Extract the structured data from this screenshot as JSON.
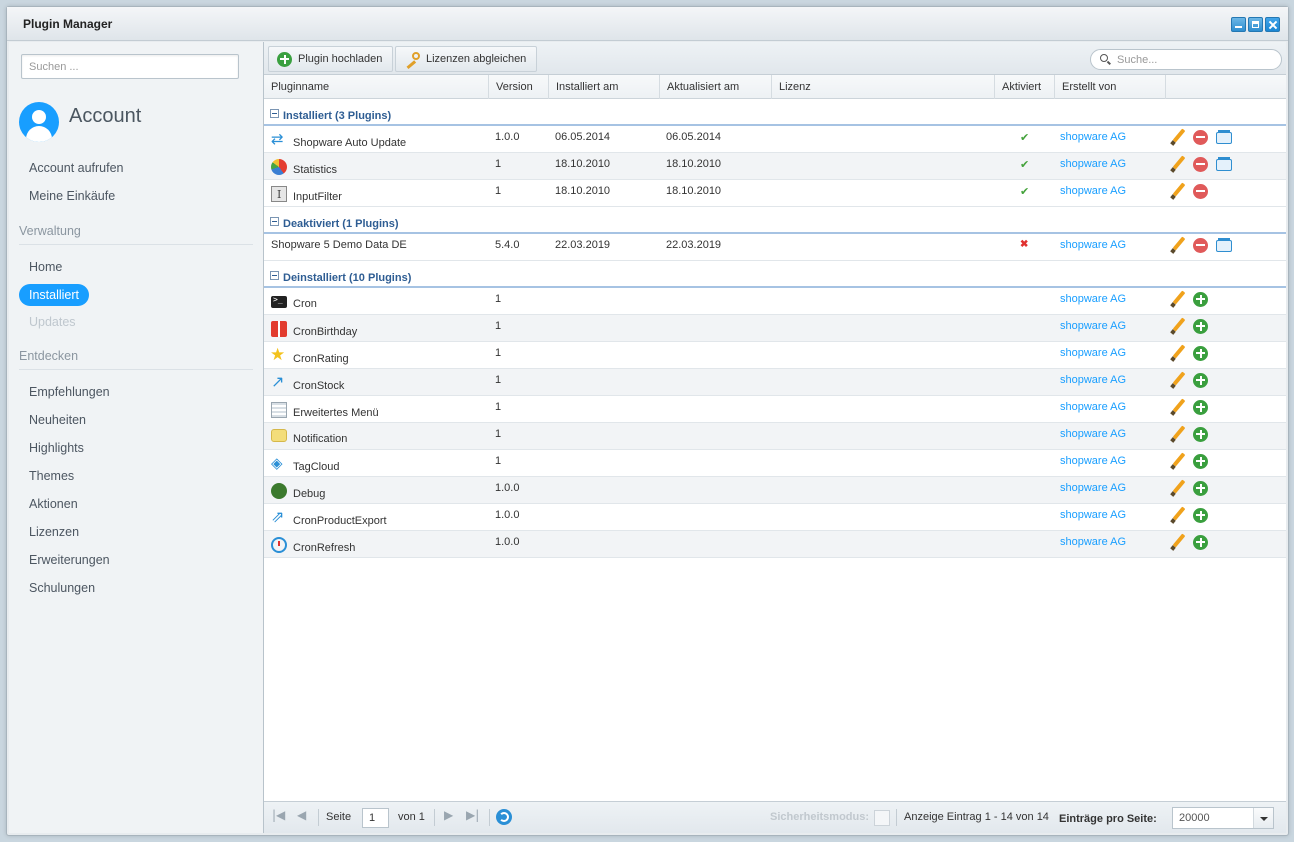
{
  "window": {
    "title": "Plugin Manager"
  },
  "sidebar": {
    "search_placeholder": "Suchen ...",
    "account_title": "Account",
    "account_links": [
      "Account aufrufen",
      "Meine Einkäufe"
    ],
    "section_verwaltung": "Verwaltung",
    "verwaltung_items": [
      {
        "label": "Home",
        "state": "normal"
      },
      {
        "label": "Installiert",
        "state": "active"
      },
      {
        "label": "Updates",
        "state": "disabled"
      }
    ],
    "section_entdecken": "Entdecken",
    "entdecken_items": [
      "Empfehlungen",
      "Neuheiten",
      "Highlights",
      "Themes",
      "Aktionen",
      "Lizenzen",
      "Erweiterungen",
      "Schulungen"
    ]
  },
  "toolbar": {
    "upload_label": "Plugin hochladen",
    "licenses_label": "Lizenzen abgleichen",
    "search_placeholder": "Suche..."
  },
  "columns": [
    "Pluginname",
    "Version",
    "Installiert am",
    "Aktualisiert am",
    "Lizenz",
    "Aktiviert",
    "Erstellt von"
  ],
  "groups": [
    {
      "title": "Installiert (3 Plugins)",
      "rows": [
        {
          "name": "Shopware Auto Update",
          "icon": "pi-update",
          "version": "1.0.0",
          "installed": "06.05.2014",
          "updated": "06.05.2014",
          "active": "check",
          "author": "shopware AG",
          "actions": [
            "edit",
            "uninstall",
            "update"
          ]
        },
        {
          "name": "Statistics",
          "icon": "pi-stats",
          "version": "1",
          "installed": "18.10.2010",
          "updated": "18.10.2010",
          "active": "check",
          "author": "shopware AG",
          "actions": [
            "edit",
            "uninstall",
            "update"
          ]
        },
        {
          "name": "InputFilter",
          "icon": "pi-input",
          "version": "1",
          "installed": "18.10.2010",
          "updated": "18.10.2010",
          "active": "check",
          "author": "shopware AG",
          "actions": [
            "edit",
            "uninstall"
          ]
        }
      ]
    },
    {
      "title": "Deaktiviert (1 Plugins)",
      "rows": [
        {
          "name": "Shopware 5 Demo Data DE",
          "icon": "",
          "version": "5.4.0",
          "installed": "22.03.2019",
          "updated": "22.03.2019",
          "active": "cross",
          "author": "shopware AG",
          "actions": [
            "edit",
            "uninstall",
            "update"
          ]
        }
      ]
    },
    {
      "title": "Deinstalliert (10 Plugins)",
      "rows": [
        {
          "name": "Cron",
          "icon": "pi-cron",
          "version": "1",
          "installed": "",
          "updated": "",
          "active": "",
          "author": "shopware AG",
          "actions": [
            "edit",
            "install"
          ]
        },
        {
          "name": "CronBirthday",
          "icon": "pi-gift",
          "version": "1",
          "installed": "",
          "updated": "",
          "active": "",
          "author": "shopware AG",
          "actions": [
            "edit",
            "install"
          ]
        },
        {
          "name": "CronRating",
          "icon": "pi-star",
          "version": "1",
          "installed": "",
          "updated": "",
          "active": "",
          "author": "shopware AG",
          "actions": [
            "edit",
            "install"
          ]
        },
        {
          "name": "CronStock",
          "icon": "pi-stock",
          "version": "1",
          "installed": "",
          "updated": "",
          "active": "",
          "author": "shopware AG",
          "actions": [
            "edit",
            "install"
          ]
        },
        {
          "name": "Erweitertes Menü",
          "icon": "pi-menu",
          "version": "1",
          "installed": "",
          "updated": "",
          "active": "",
          "author": "shopware AG",
          "actions": [
            "edit",
            "install"
          ]
        },
        {
          "name": "Notification",
          "icon": "pi-note",
          "version": "1",
          "installed": "",
          "updated": "",
          "active": "",
          "author": "shopware AG",
          "actions": [
            "edit",
            "install"
          ]
        },
        {
          "name": "TagCloud",
          "icon": "pi-tag",
          "version": "1",
          "installed": "",
          "updated": "",
          "active": "",
          "author": "shopware AG",
          "actions": [
            "edit",
            "install"
          ]
        },
        {
          "name": "Debug",
          "icon": "pi-bug",
          "version": "1.0.0",
          "installed": "",
          "updated": "",
          "active": "",
          "author": "shopware AG",
          "actions": [
            "edit",
            "install"
          ]
        },
        {
          "name": "CronProductExport",
          "icon": "pi-export",
          "version": "1.0.0",
          "installed": "",
          "updated": "",
          "active": "",
          "author": "shopware AG",
          "actions": [
            "edit",
            "install"
          ]
        },
        {
          "name": "CronRefresh",
          "icon": "pi-refresh",
          "version": "1.0.0",
          "installed": "",
          "updated": "",
          "active": "",
          "author": "shopware AG",
          "actions": [
            "edit",
            "install"
          ]
        }
      ]
    }
  ],
  "paging": {
    "page_label": "Seite",
    "page_value": "1",
    "of_label": "von 1",
    "safe_mode_label": "Sicherheitsmodus:",
    "display_info": "Anzeige Eintrag 1 - 14 von 14",
    "per_page_label": "Einträge pro Seite:",
    "per_page_value": "20000"
  }
}
